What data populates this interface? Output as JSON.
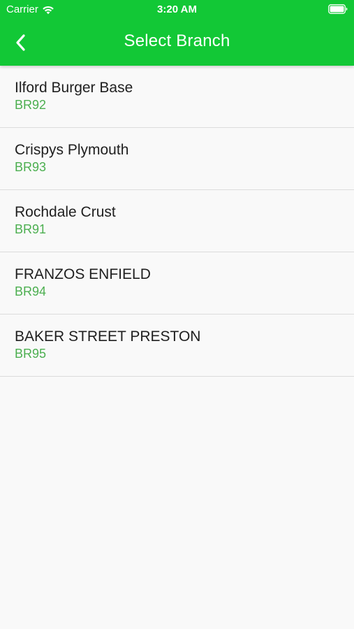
{
  "status_bar": {
    "carrier": "Carrier",
    "time": "3:20 AM",
    "icons": [
      "wifi-icon",
      "battery-icon"
    ]
  },
  "app_bar": {
    "title": "Select Branch",
    "back_icon": "chevron-left-icon",
    "background_color": "#12c836",
    "text_color": "#ffffff"
  },
  "branches": [
    {
      "name": "Ilford Burger Base",
      "code": "BR92"
    },
    {
      "name": "Crispys Plymouth",
      "code": "BR93"
    },
    {
      "name": "Rochdale Crust",
      "code": "BR91"
    },
    {
      "name": "FRANZOS ENFIELD",
      "code": "BR94"
    },
    {
      "name": "BAKER STREET PRESTON",
      "code": "BR95"
    }
  ],
  "colors": {
    "accent": "#12c836",
    "code_text": "#4caf50",
    "name_text": "#1f1f1f",
    "divider": "#dcdcdc",
    "background": "#f9f9f9"
  }
}
